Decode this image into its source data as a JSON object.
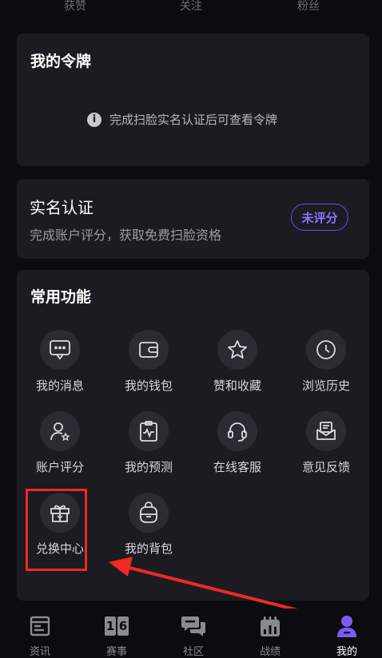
{
  "stats": {
    "likes": "获赞",
    "following": "关注",
    "fans": "粉丝"
  },
  "token_card": {
    "title": "我的令牌",
    "tip": "完成扫脸实名认证后可查看令牌"
  },
  "realname_card": {
    "title": "实名认证",
    "subtitle": "完成账户评分，获取免费扫脸资格",
    "button": "未评分"
  },
  "features": {
    "title": "常用功能",
    "items": [
      {
        "label": "我的消息",
        "icon": "message-icon"
      },
      {
        "label": "我的钱包",
        "icon": "wallet-icon"
      },
      {
        "label": "赞和收藏",
        "icon": "star-icon"
      },
      {
        "label": "浏览历史",
        "icon": "clock-icon"
      },
      {
        "label": "账户评分",
        "icon": "user-star-icon"
      },
      {
        "label": "我的预测",
        "icon": "clipboard-chart-icon"
      },
      {
        "label": "在线客服",
        "icon": "headset-icon"
      },
      {
        "label": "意见反馈",
        "icon": "mail-feedback-icon"
      },
      {
        "label": "兑换中心",
        "icon": "gift-icon"
      },
      {
        "label": "我的背包",
        "icon": "backpack-icon"
      }
    ]
  },
  "tabbar": {
    "items": [
      {
        "label": "资讯",
        "icon": "news-icon"
      },
      {
        "label": "赛事",
        "icon": "scoreboard-icon",
        "glyph_left": "1",
        "glyph_right": "6"
      },
      {
        "label": "社区",
        "icon": "chat-bubbles-icon"
      },
      {
        "label": "战绩",
        "icon": "stats-icon"
      },
      {
        "label": "我的",
        "icon": "profile-icon",
        "active": true
      }
    ]
  },
  "colors": {
    "accent": "#6a4ee8",
    "highlight": "#ee2a22",
    "card": "#1b1b21",
    "background": "#0c0c10"
  }
}
